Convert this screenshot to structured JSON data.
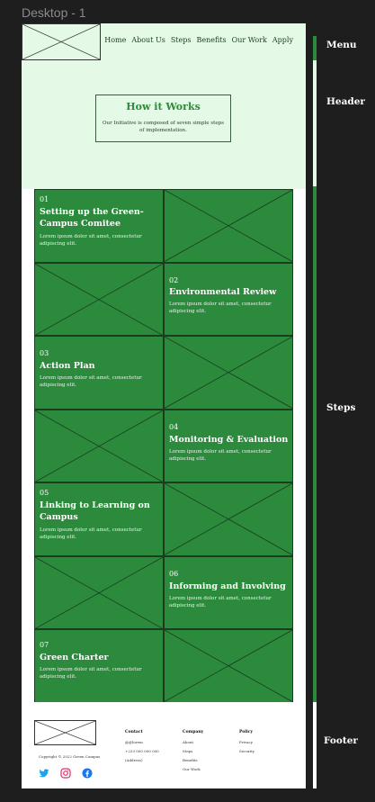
{
  "frame": {
    "label": "Desktop - 1"
  },
  "nav": {
    "items": [
      "Home",
      "About Us",
      "Steps",
      "Benefits",
      "Our Work",
      "Apply"
    ]
  },
  "hero": {
    "title": "How it Works",
    "subtitle": "Our Initiative is composed of seven simple steps of implementation."
  },
  "steps": [
    {
      "num": "01",
      "title": "Setting up the Green-Campus Comitee",
      "desc": "Lorem ipsum dolor sit amet, consectetur adipiscing elit."
    },
    {
      "num": "02",
      "title": "Environmental Review",
      "desc": "Lorem ipsum dolor sit amet, consectetur adipiscing elit."
    },
    {
      "num": "03",
      "title": "Action Plan",
      "desc": "Lorem ipsum dolor sit amet, consectetur adipiscing elit."
    },
    {
      "num": "04",
      "title": "Monitoring & Evaluation",
      "desc": "Lorem ipsum dolor sit amet, consectetur adipiscing elit."
    },
    {
      "num": "05",
      "title": "Linking to Learning on Campus",
      "desc": "Lorem ipsum dolor sit amet, consectetur adipiscing elit."
    },
    {
      "num": "06",
      "title": "Informing and Involving",
      "desc": "Lorem ipsum dolor sit amet, consectetur adipiscing elit."
    },
    {
      "num": "07",
      "title": "Green Charter",
      "desc": "Lorem ipsum dolor sit amet, consectetur adipiscing elit."
    }
  ],
  "footer": {
    "copyright": "Copyright © 2022 Green Campus",
    "social_icons": [
      "twitter-icon",
      "instagram-icon",
      "facebook-icon"
    ],
    "columns": [
      {
        "heading": "Contact",
        "items": [
          "@@lorem",
          "+233 000 000 000",
          "(Address)"
        ]
      },
      {
        "heading": "Company",
        "items": [
          "About",
          "Steps",
          "Benefits",
          "Our Work"
        ]
      },
      {
        "heading": "Policy",
        "items": [
          "Privacy",
          "Security"
        ]
      }
    ]
  },
  "sidebar": {
    "sections": [
      "Menu",
      "Header",
      "Steps",
      "Footer"
    ]
  },
  "colors": {
    "canvas": "#1e1e1e",
    "header_bg": "#e4f9e6",
    "step_green": "#2c8a3c",
    "title_green": "#2e8a3a",
    "twitter": "#1da1f2",
    "instagram": "#e1306c",
    "facebook": "#1877f2"
  }
}
